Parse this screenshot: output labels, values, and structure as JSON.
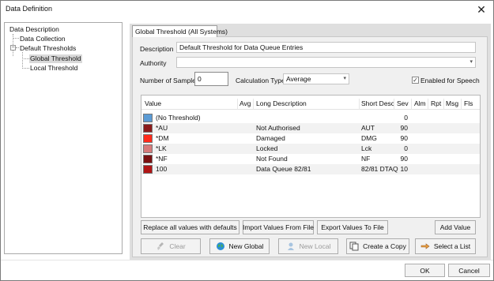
{
  "window": {
    "title": "Data Definition",
    "close_glyph": "✕"
  },
  "tree": {
    "items": [
      {
        "label": "Data Description"
      },
      {
        "label": "Data Collection"
      },
      {
        "label": "Default Thresholds"
      },
      {
        "label": "Global Threshold",
        "selected": true
      },
      {
        "label": "Local Threshold"
      }
    ],
    "collapse_glyph": "−"
  },
  "tab": {
    "label": "Global Threshold (All Systems)"
  },
  "form": {
    "description_label": "Description",
    "description_value": "Default Threshold for Data Queue Entries",
    "authority_label": "Authority",
    "authority_value": "",
    "samples_label": "Number of Samples",
    "samples_value": "0",
    "calc_type_label": "Calculation Type",
    "calc_type_value": "Average",
    "speech_label": "Enabled for Speech",
    "speech_checked": true,
    "dropdown_glyph": "▾",
    "check_glyph": "✓"
  },
  "grid": {
    "columns": [
      "Value",
      "Avg",
      "Long Description",
      "Short Desc",
      "Sev",
      "Alm",
      "Rpt",
      "Msg",
      "Fls"
    ],
    "rows": [
      {
        "color": "#5b9bd5",
        "value": "(No Threshold)",
        "avg": "",
        "long": "",
        "short": "",
        "sev": "0"
      },
      {
        "color": "#8b1a1a",
        "value": "*AU",
        "avg": "",
        "long": "Not Authorised",
        "short": "AUT",
        "sev": "90"
      },
      {
        "color": "#ff2a1a",
        "value": "*DM",
        "avg": "",
        "long": "Damaged",
        "short": "DMG",
        "sev": "90"
      },
      {
        "color": "#d77a7a",
        "value": "*LK",
        "avg": "",
        "long": "Locked",
        "short": "Lck",
        "sev": "0"
      },
      {
        "color": "#7a1010",
        "value": "*NF",
        "avg": "",
        "long": "Not Found",
        "short": "NF",
        "sev": "90"
      },
      {
        "color": "#b01515",
        "value": "100",
        "avg": "",
        "long": "Data Queue 82/81",
        "short": "82/81 DTAQ",
        "sev": "10"
      }
    ]
  },
  "buttons": {
    "replace": "Replace all values with defaults",
    "import": "Import Values From File",
    "export": "Export Values To File",
    "add_value": "Add Value",
    "clear": "Clear",
    "new_global": "New Global",
    "new_local": "New Local",
    "create_copy": "Create a Copy",
    "select_list": "Select a List",
    "ok": "OK",
    "cancel": "Cancel"
  }
}
